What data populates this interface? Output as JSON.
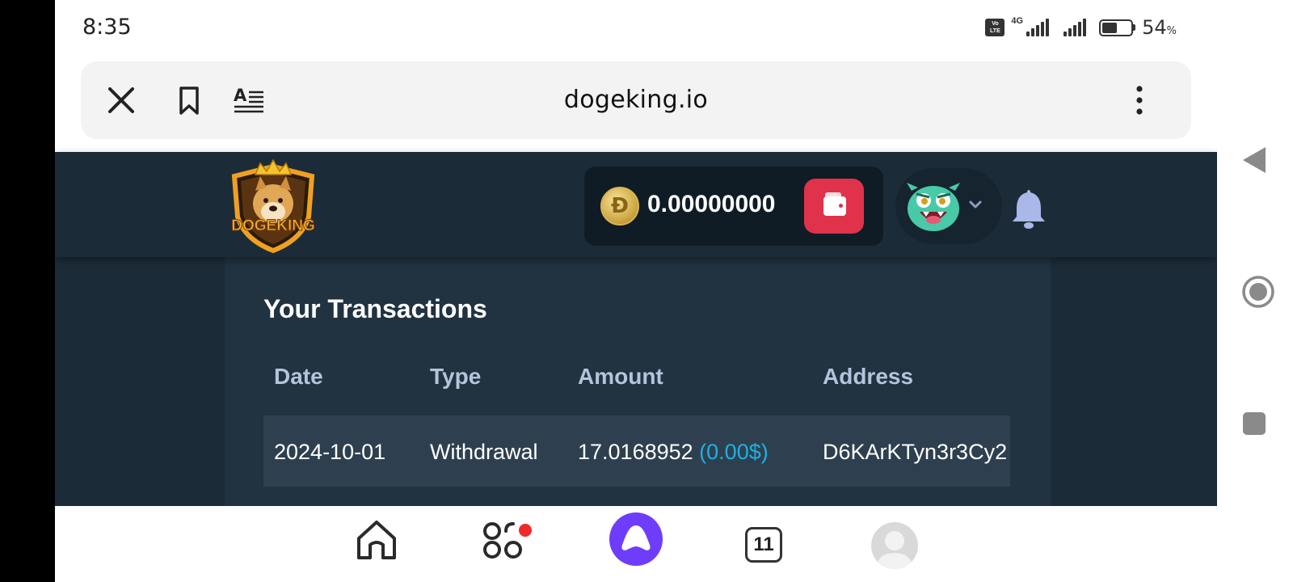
{
  "status_bar": {
    "time": "8:35",
    "network": "4G",
    "battery_percent": "54",
    "battery_unit": "%"
  },
  "browser": {
    "url": "dogeking.io"
  },
  "header": {
    "logo_text": "DOGEKING",
    "balance": "0.00000000"
  },
  "transactions": {
    "title": "Your Transactions",
    "columns": [
      "Date",
      "Type",
      "Amount",
      "Address"
    ],
    "rows": [
      {
        "date": "2024-10-01",
        "type": "Withdrawal",
        "amount": "17.0168952",
        "usd": "(0.00$)",
        "address": "D6KArKTyn3r3Cy2"
      }
    ]
  },
  "bottom_nav": {
    "tabs_count": "11"
  },
  "colors": {
    "header_bg": "#1c2b38",
    "panel_bg": "#213240",
    "wallet_button": "#e0324b",
    "usd_accent": "#1fb0e0",
    "alice": "#6e3dfb"
  },
  "icons": [
    "close-icon",
    "bookmark-icon",
    "reader-mode-icon",
    "more-vert-icon",
    "wallet-icon",
    "chevron-down-icon",
    "bell-icon",
    "home-icon",
    "apps-icon",
    "alice-icon",
    "tabs-icon",
    "profile-icon",
    "back-icon",
    "home-circle-icon",
    "recents-icon"
  ]
}
